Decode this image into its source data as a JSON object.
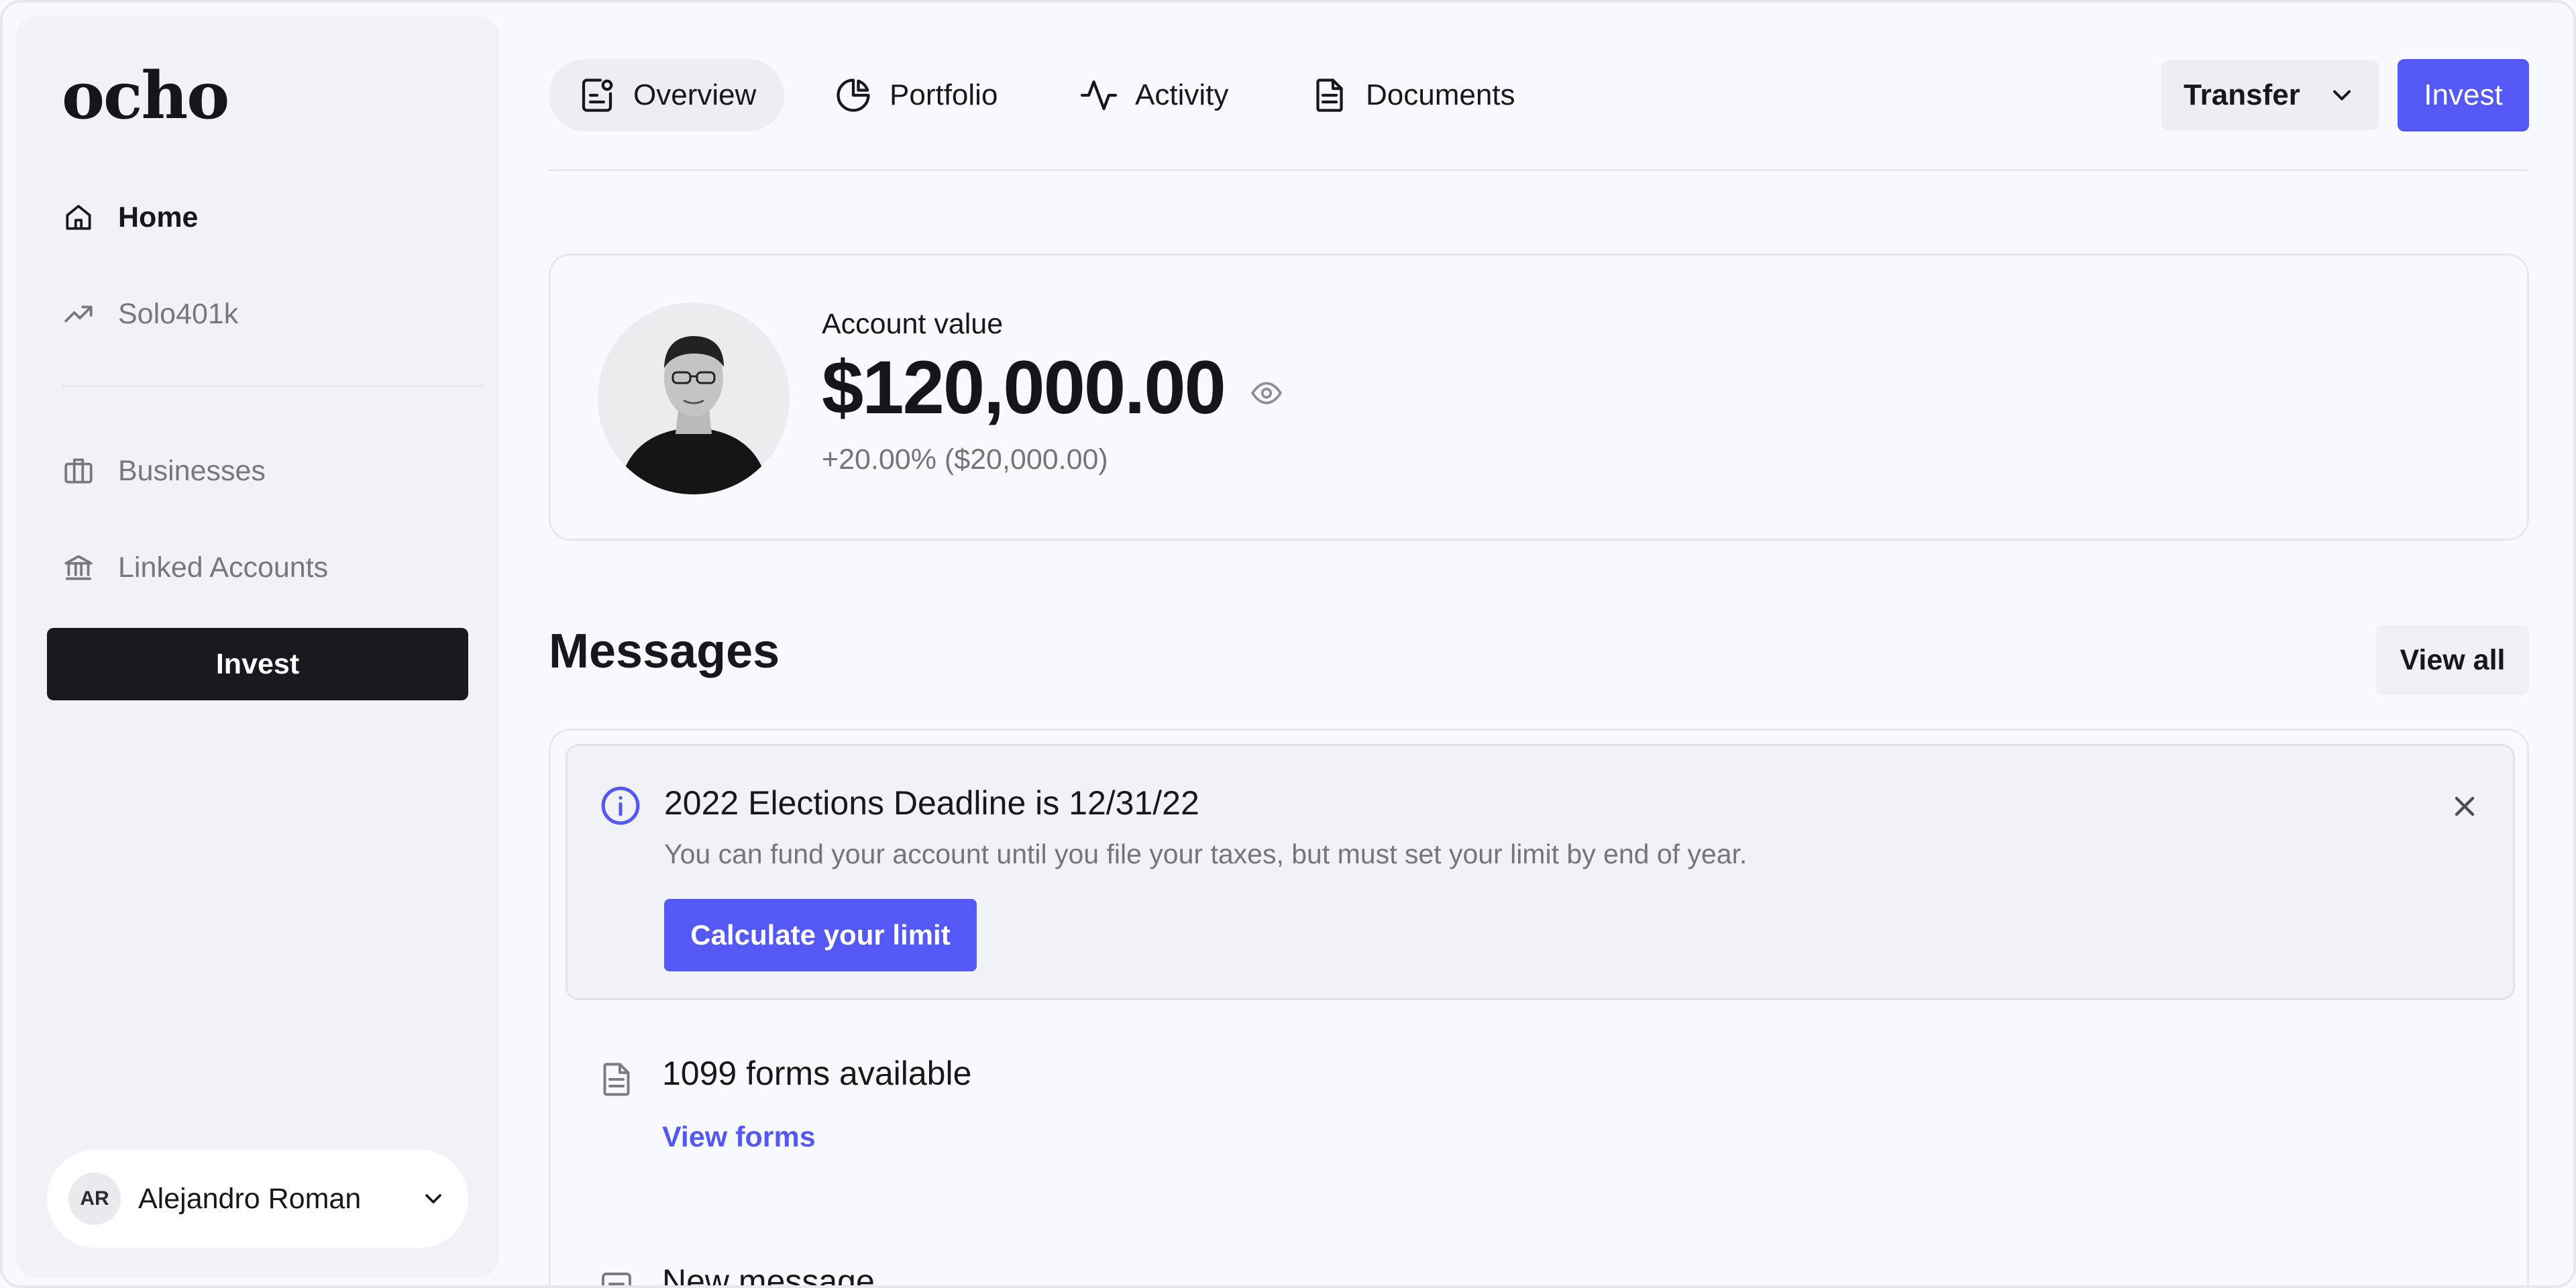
{
  "brand": {
    "logo": "ocho"
  },
  "sidebar": {
    "items": [
      {
        "label": "Home",
        "icon": "home-icon",
        "active": true
      },
      {
        "label": "Solo401k",
        "icon": "trending-up-icon",
        "active": false
      },
      {
        "label": "Businesses",
        "icon": "briefcase-icon",
        "active": false
      },
      {
        "label": "Linked Accounts",
        "icon": "bank-icon",
        "active": false
      }
    ],
    "invest_label": "Invest",
    "user": {
      "initials": "AR",
      "name": "Alejandro Roman"
    }
  },
  "topnav": {
    "tabs": [
      {
        "label": "Overview",
        "icon": "overview-icon",
        "active": true
      },
      {
        "label": "Portfolio",
        "icon": "pie-chart-icon",
        "active": false
      },
      {
        "label": "Activity",
        "icon": "activity-icon",
        "active": false
      },
      {
        "label": "Documents",
        "icon": "document-icon",
        "active": false
      }
    ],
    "transfer_label": "Transfer",
    "invest_label": "Invest"
  },
  "account": {
    "label": "Account value",
    "value": "$120,000.00",
    "change": "+20.00% ($20,000.00)"
  },
  "messages": {
    "title": "Messages",
    "view_all_label": "View all",
    "items": [
      {
        "title": "2022 Elections Deadline is 12/31/22",
        "text": "You can fund your account until you file your taxes, but must set your limit by end of year.",
        "action": "Calculate your limit"
      },
      {
        "title": "1099 forms available",
        "action": "View forms"
      },
      {
        "title": "New message"
      }
    ]
  },
  "colors": {
    "accent": "#5459f5",
    "dark": "#17191e",
    "muted": "#72757c",
    "background": "#f8f9fc"
  }
}
